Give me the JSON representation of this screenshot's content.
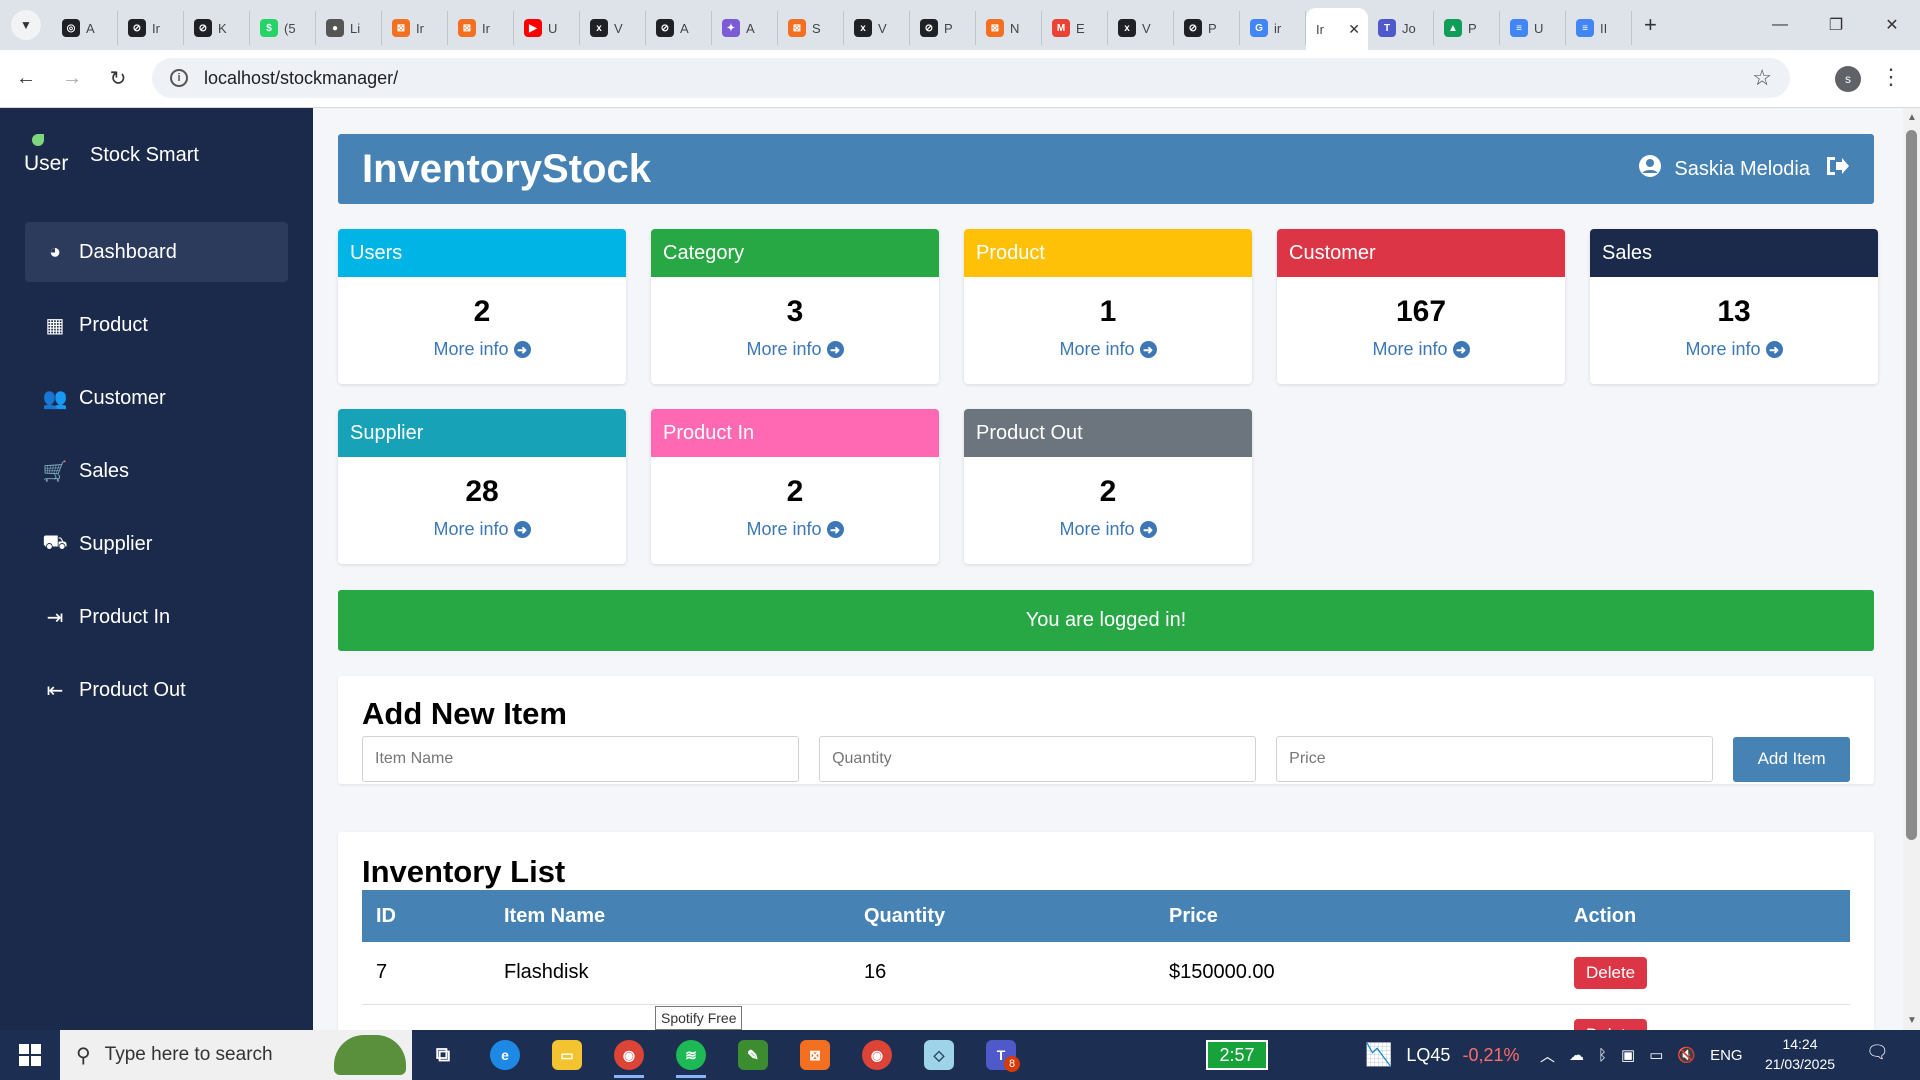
{
  "browser": {
    "tabs": [
      {
        "letter": "A",
        "color": "#202124",
        "glyph": "◎"
      },
      {
        "letter": "Ir",
        "color": "#202124",
        "glyph": "⊘"
      },
      {
        "letter": "K",
        "color": "#202124",
        "glyph": "⊘"
      },
      {
        "letter": "(5",
        "color": "#25d366",
        "glyph": "$"
      },
      {
        "letter": "Li",
        "color": "#555555",
        "glyph": "●"
      },
      {
        "letter": "Ir",
        "color": "#f37021",
        "glyph": "⊠"
      },
      {
        "letter": "Ir",
        "color": "#f37021",
        "glyph": "⊠"
      },
      {
        "letter": "U",
        "color": "#ff0000",
        "glyph": "▶"
      },
      {
        "letter": "V",
        "color": "#202124",
        "glyph": "x"
      },
      {
        "letter": "A",
        "color": "#202124",
        "glyph": "⊘"
      },
      {
        "letter": "A",
        "color": "#7b5cd6",
        "glyph": "✦"
      },
      {
        "letter": "S",
        "color": "#f37021",
        "glyph": "⊠"
      },
      {
        "letter": "V",
        "color": "#202124",
        "glyph": "x"
      },
      {
        "letter": "P",
        "color": "#202124",
        "glyph": "⊘"
      },
      {
        "letter": "N",
        "color": "#f37021",
        "glyph": "⊠"
      },
      {
        "letter": "E",
        "color": "#ea4335",
        "glyph": "M"
      },
      {
        "letter": "V",
        "color": "#202124",
        "glyph": "x"
      },
      {
        "letter": "P",
        "color": "#202124",
        "glyph": "⊘"
      },
      {
        "letter": "ir",
        "color": "#4285f4",
        "glyph": "G"
      }
    ],
    "active_tab": {
      "letter": "Ir"
    },
    "tabs_after": [
      {
        "letter": "Jo",
        "color": "#5059c9",
        "glyph": "T"
      },
      {
        "letter": "P",
        "color": "#0f9d58",
        "glyph": "▲"
      },
      {
        "letter": "U",
        "color": "#4285f4",
        "glyph": "≡"
      },
      {
        "letter": "II",
        "color": "#4285f4",
        "glyph": "≡"
      }
    ],
    "url": "localhost/stockmanager/",
    "profile_initial": "s"
  },
  "sidebar": {
    "logo_text": "User",
    "brand": "Stock Smart",
    "items": [
      {
        "label": "Dashboard",
        "icon": "gauge-icon",
        "glyph": "◕"
      },
      {
        "label": "Product",
        "icon": "box-icon",
        "glyph": "▦"
      },
      {
        "label": "Customer",
        "icon": "users-icon",
        "glyph": "👥"
      },
      {
        "label": "Sales",
        "icon": "cart-icon",
        "glyph": "🛒"
      },
      {
        "label": "Supplier",
        "icon": "truck-icon",
        "glyph": "⛟"
      },
      {
        "label": "Product In",
        "icon": "sign-in-icon",
        "glyph": "⇥"
      },
      {
        "label": "Product Out",
        "icon": "sign-out-icon",
        "glyph": "⇤"
      }
    ]
  },
  "header": {
    "title": "InventoryStock",
    "user_name": "Saskia Melodia"
  },
  "cards": [
    {
      "title": "Users",
      "count": "2",
      "link": "More info",
      "color": "#00b4e6",
      "title_color": "#ffffff"
    },
    {
      "title": "Category",
      "count": "3",
      "link": "More info",
      "color": "#28a745",
      "title_color": "#ffffff"
    },
    {
      "title": "Product",
      "count": "1",
      "link": "More info",
      "color": "#ffc107",
      "title_color": "#ffffff"
    },
    {
      "title": "Customer",
      "count": "167",
      "link": "More info",
      "color": "#dc3545",
      "title_color": "#ffffff"
    },
    {
      "title": "Sales",
      "count": "13",
      "link": "More info",
      "color": "#1b2a4a",
      "title_color": "#ffffff"
    },
    {
      "title": "Supplier",
      "count": "28",
      "link": "More info",
      "color": "#17a2b8",
      "title_color": "#ffffff"
    },
    {
      "title": "Product In",
      "count": "2",
      "link": "More info",
      "color": "#ff69b4",
      "title_color": "#ffffff"
    },
    {
      "title": "Product Out",
      "count": "2",
      "link": "More info",
      "color": "#6c757d",
      "title_color": "#ffffff"
    }
  ],
  "alert": {
    "text": "You are logged in!"
  },
  "add_form": {
    "title": "Add New Item",
    "item_name_placeholder": "Item Name",
    "quantity_placeholder": "Quantity",
    "price_placeholder": "Price",
    "button": "Add Item"
  },
  "inventory": {
    "title": "Inventory List",
    "columns": [
      "ID",
      "Item Name",
      "Quantity",
      "Price",
      "Action"
    ],
    "rows": [
      {
        "id": "7",
        "name": "Flashdisk",
        "quantity": "16",
        "price": "$150000.00",
        "action": "Delete"
      },
      {
        "id": "",
        "name": "",
        "quantity": "",
        "price": "",
        "action": "Delete"
      }
    ]
  },
  "tooltip": "Spotify Free",
  "taskbar": {
    "search_placeholder": "Type here to search",
    "battery_time": "2:57",
    "stock_symbol": "LQ45",
    "stock_change": "-0,21%",
    "language": "ENG",
    "time": "14:24",
    "date": "21/03/2025",
    "notification_count": "1"
  }
}
